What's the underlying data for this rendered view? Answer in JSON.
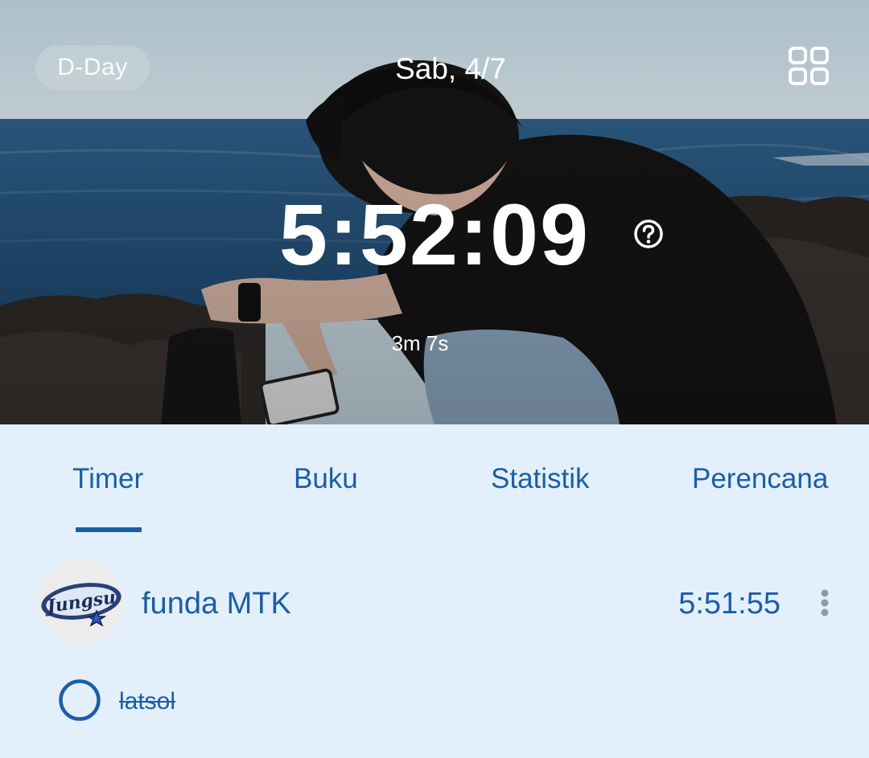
{
  "header": {
    "dday_label": "D-Day",
    "date": "Sab, 4/7",
    "icons": {
      "grid": "grid-icon",
      "help": "help-circle-icon"
    }
  },
  "timer": {
    "total": "5:52:09",
    "session": "3m 7s"
  },
  "tabs": [
    {
      "label": "Timer",
      "active": true
    },
    {
      "label": "Buku",
      "active": false
    },
    {
      "label": "Statistik",
      "active": false
    },
    {
      "label": "Perencana",
      "active": false
    }
  ],
  "subjects": [
    {
      "name": "funda MTK",
      "time": "5:51:55",
      "avatar_text": "Jungsu",
      "menu_icon": "more-vertical-icon"
    }
  ],
  "tasks": [
    {
      "label": "latsol",
      "done": true
    }
  ],
  "colors": {
    "accent": "#1b5ea6",
    "background": "#e3f0fb",
    "hero_text": "#ffffff"
  }
}
